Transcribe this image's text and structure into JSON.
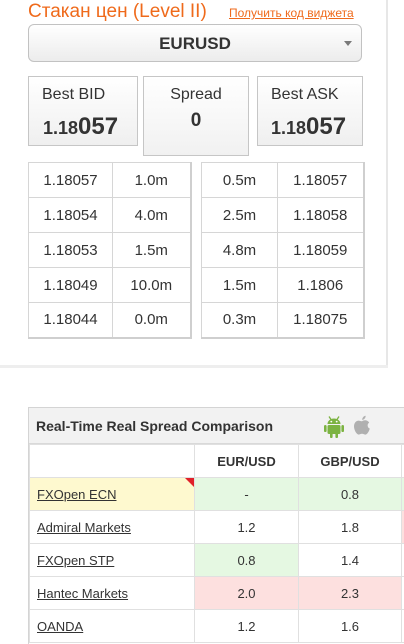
{
  "orderbook": {
    "title": "Стакан цен (Level II)",
    "get_code_link": "Получить код виджета",
    "symbol": "EURUSD",
    "best_bid": {
      "label": "Best BID",
      "prefix": "1.18",
      "big": "05",
      "suffix": "7"
    },
    "spread": {
      "label": "Spread",
      "value": "0"
    },
    "best_ask": {
      "label": "Best ASK",
      "prefix": "1.18",
      "big": "05",
      "suffix": "7"
    },
    "bids": [
      {
        "price": "1.18057",
        "volume": "1.0m"
      },
      {
        "price": "1.18054",
        "volume": "4.0m"
      },
      {
        "price": "1.18053",
        "volume": "1.5m"
      },
      {
        "price": "1.18049",
        "volume": "10.0m"
      },
      {
        "price": "1.18044",
        "volume": "0.0m"
      }
    ],
    "asks": [
      {
        "volume": "0.5m",
        "price": "1.18057"
      },
      {
        "volume": "2.5m",
        "price": "1.18058"
      },
      {
        "volume": "4.8m",
        "price": "1.18059"
      },
      {
        "volume": "1.5m",
        "price": "1.1806"
      },
      {
        "volume": "0.3m",
        "price": "1.18075"
      }
    ]
  },
  "comparison": {
    "title": "Real-Time Real Spread Comparison",
    "platform_icons": [
      "android-icon",
      "apple-icon"
    ],
    "columns": [
      "",
      "EUR/USD",
      "GBP/USD"
    ],
    "rows": [
      {
        "broker": "FXOpen ECN",
        "eurusd": "-",
        "gbpusd": "0.8"
      },
      {
        "broker": "Admiral Markets",
        "eurusd": "1.2",
        "gbpusd": "1.8"
      },
      {
        "broker": "FXOpen STP",
        "eurusd": "0.8",
        "gbpusd": "1.4"
      },
      {
        "broker": "Hantec Markets",
        "eurusd": "2.0",
        "gbpusd": "2.3"
      },
      {
        "broker": "OANDA",
        "eurusd": "1.2",
        "gbpusd": "1.6"
      }
    ],
    "colors": {
      "best": "#e5f8e2",
      "worst": "#fde0df",
      "highlight": "#fef9cf",
      "accent": "#ef6a1b",
      "android": "#7cb342",
      "apple": "#b0b0b0"
    }
  }
}
